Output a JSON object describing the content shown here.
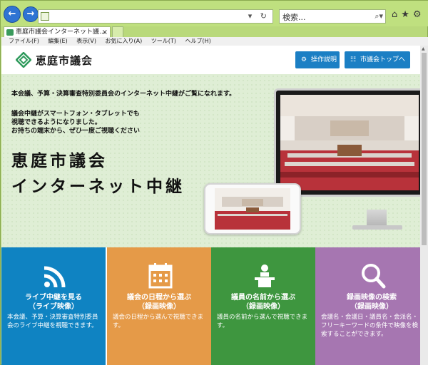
{
  "browser": {
    "search_placeholder": "検索...",
    "tab_title": "恵庭市議会インターネット議...",
    "menu": [
      "ファイル(F)",
      "編集(E)",
      "表示(V)",
      "お気に入り(A)",
      "ツール(T)",
      "ヘルプ(H)"
    ]
  },
  "header": {
    "logo_text": "恵庭市議会",
    "guide_button": "操作説明",
    "top_button": "市議会トップへ"
  },
  "hero": {
    "intro": "本会議、予算・決算審査特別委員会のインターネット中継がご覧になれます。",
    "lines": [
      "議会中継がスマートフォン・タブレットでも",
      "視聴できるようになりました。",
      "お持ちの端末から、ぜひ一度ご視聴ください"
    ],
    "title_line1": "恵庭市議会",
    "title_line2": "インターネット中継"
  },
  "tiles": [
    {
      "title1": "ライブ中継を見る",
      "title2": "（ライブ映像）",
      "desc": "本会議、予算・決算審査特別委員会のライブ中継を視聴できます。",
      "icon": "wifi-icon",
      "color": "#0f83c2"
    },
    {
      "title1": "議会の日程から選ぶ",
      "title2": "（録画映像）",
      "desc": "議会の日程から選んで視聴できます。",
      "icon": "calendar-icon",
      "color": "#e59a48"
    },
    {
      "title1": "議員の名前から選ぶ",
      "title2": "（録画映像）",
      "desc": "議員の名前から選んで視聴できます。",
      "icon": "speaker-podium-icon",
      "color": "#3e963f"
    },
    {
      "title1": "録画映像の検索",
      "title2": "（録画映像）",
      "desc": "会議名・会議日・議員名・会派名・フリーキーワードの条件で映像を検索することができます。",
      "icon": "search-icon",
      "color": "#a676b1"
    }
  ]
}
